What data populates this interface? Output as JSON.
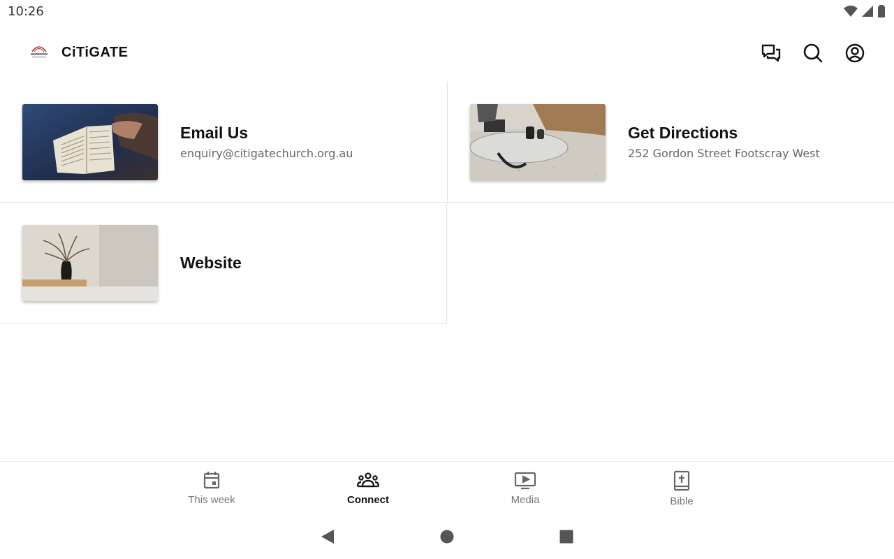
{
  "status_bar": {
    "time": "10:26"
  },
  "app": {
    "title": "CiTiGATE",
    "logo_text": "CiTiGATE"
  },
  "colors": {
    "accent": "#111111",
    "muted": "#777777",
    "logo_red": "#b3262c"
  },
  "actions": [
    {
      "icon": "chat-icon"
    },
    {
      "icon": "search-icon"
    },
    {
      "icon": "account-icon"
    }
  ],
  "cards": [
    {
      "title": "Email Us",
      "subtitle": "enquiry@citigatechurch.org.au",
      "thumb": "bible-photo"
    },
    {
      "title": "Get Directions",
      "subtitle": "252 Gordon Street Footscray West",
      "thumb": "living-room-photo"
    },
    {
      "title": "Website",
      "subtitle": "",
      "thumb": "vase-photo"
    }
  ],
  "bottom_nav": [
    {
      "label": "This week",
      "icon": "calendar-icon"
    },
    {
      "label": "Connect",
      "icon": "people-icon",
      "active": true
    },
    {
      "label": "Media",
      "icon": "video-icon"
    },
    {
      "label": "Bible",
      "icon": "bible-icon"
    }
  ]
}
